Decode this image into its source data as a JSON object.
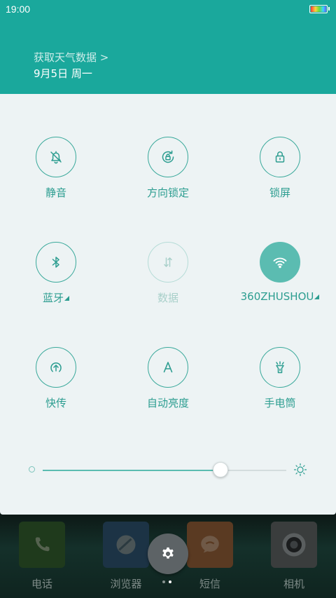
{
  "status_bar": {
    "time": "19:00"
  },
  "header": {
    "weather_link": "获取天气数据 >",
    "date": "9月5日 周一"
  },
  "toggles": [
    {
      "label": "静音",
      "icon": "bell-off-icon",
      "state": "off"
    },
    {
      "label": "方向锁定",
      "icon": "rotation-lock-icon",
      "state": "off"
    },
    {
      "label": "锁屏",
      "icon": "lock-icon",
      "state": "off"
    },
    {
      "label": "蓝牙",
      "icon": "bluetooth-icon",
      "state": "off",
      "has_more": true
    },
    {
      "label": "数据",
      "icon": "mobile-data-icon",
      "state": "disabled"
    },
    {
      "label": "360ZHUSHOU",
      "icon": "wifi-icon",
      "state": "on",
      "has_more": true
    },
    {
      "label": "快传",
      "icon": "quick-transfer-icon",
      "state": "off"
    },
    {
      "label": "自动亮度",
      "icon": "auto-brightness-icon",
      "state": "off"
    },
    {
      "label": "手电筒",
      "icon": "flashlight-icon",
      "state": "off"
    }
  ],
  "brightness": {
    "level": 0.73
  },
  "dock": {
    "items": [
      {
        "label": "电话",
        "icon": "phone-icon"
      },
      {
        "label": "浏览器",
        "icon": "browser-icon"
      },
      {
        "label": "短信",
        "icon": "message-icon"
      },
      {
        "label": "相机",
        "icon": "camera-icon"
      }
    ],
    "settings_icon": "gear-icon",
    "page_count": 2,
    "current_page": 2
  },
  "colors": {
    "header": "#1aa89c",
    "accent": "#2c9d90",
    "panel": "#edf3f4",
    "wifi_active": "#5bbcb1"
  }
}
